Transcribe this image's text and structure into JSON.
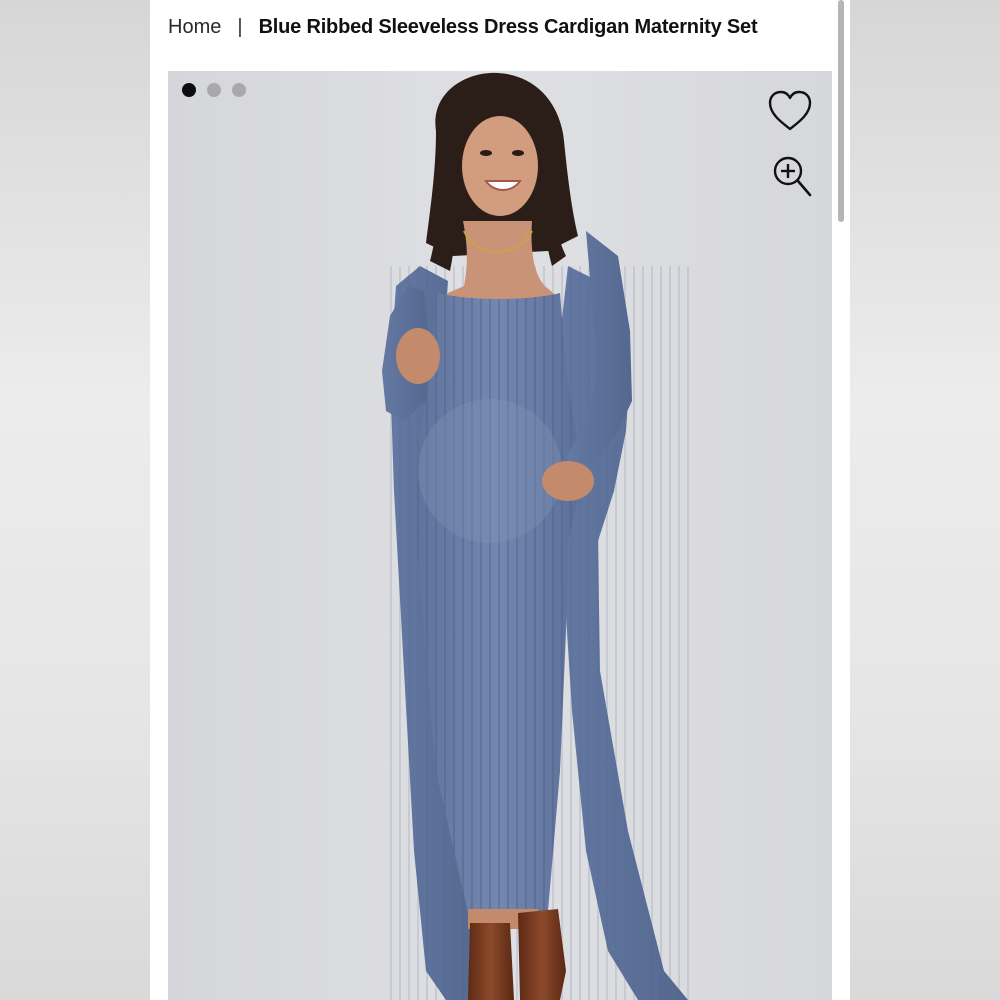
{
  "breadcrumb": {
    "home_label": "Home",
    "separator": "|",
    "current_label": "Blue Ribbed Sleeveless Dress Cardigan Maternity Set"
  },
  "gallery": {
    "image_count": 3,
    "active_index": 0,
    "wishlist_icon": "heart-icon",
    "zoom_icon": "zoom-in-icon"
  },
  "colors": {
    "dress_blue": "#6f84ad",
    "boots_brown": "#7a3a1f",
    "background_gray": "#dadbdf"
  }
}
